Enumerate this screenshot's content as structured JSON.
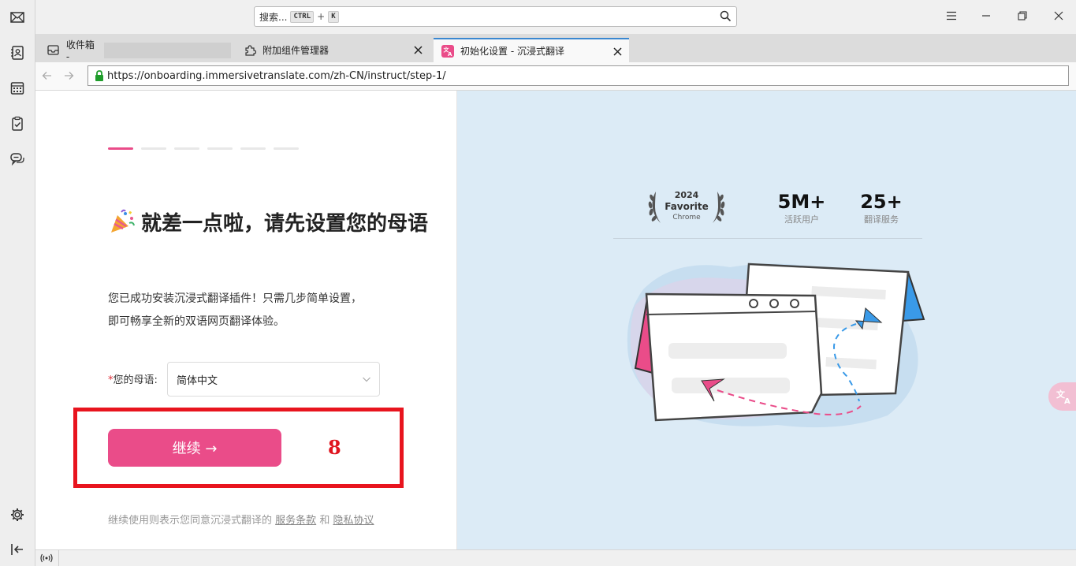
{
  "search": {
    "placeholder": "搜索...",
    "kbd_ctrl": "CTRL",
    "kbd_plus": "+",
    "kbd_key": "K"
  },
  "tabs": [
    {
      "label": "收件箱 -",
      "icon": "inbox-icon"
    },
    {
      "label": "附加组件管理器",
      "icon": "puzzle-icon"
    },
    {
      "label": "初始化设置 - 沉浸式翻译",
      "icon": "immersive-translate-icon",
      "active": true
    }
  ],
  "address": {
    "url": "https://onboarding.immersivetranslate.com/zh-CN/instruct/step-1/"
  },
  "onboarding": {
    "step_total": 6,
    "step_current": 1,
    "headline": "就差一点啦，请先设置您的母语",
    "description": "您已成功安装沉浸式翻译插件！只需几步简单设置，即可畅享全新的双语网页翻译体验。",
    "lang_required_mark": "*",
    "lang_label": "您的母语:",
    "lang_value": "简体中文",
    "continue_label": "继续 →",
    "annotation_number": "8",
    "terms_prefix": "继续使用则表示您同意沉浸式翻译的",
    "terms_link": "服务条款",
    "terms_and": "和",
    "privacy_link": "隐私协议"
  },
  "stats": {
    "award_year": "2024",
    "award_title": "Favorite",
    "award_sub": "Chrome",
    "users_num": "5M+",
    "users_label": "活跃用户",
    "services_num": "25+",
    "services_label": "翻译服务"
  },
  "colors": {
    "accent": "#ea4c89",
    "highlight": "#e8141e",
    "panel": "#dcebf6",
    "tab_active_border": "#3a87d0"
  }
}
